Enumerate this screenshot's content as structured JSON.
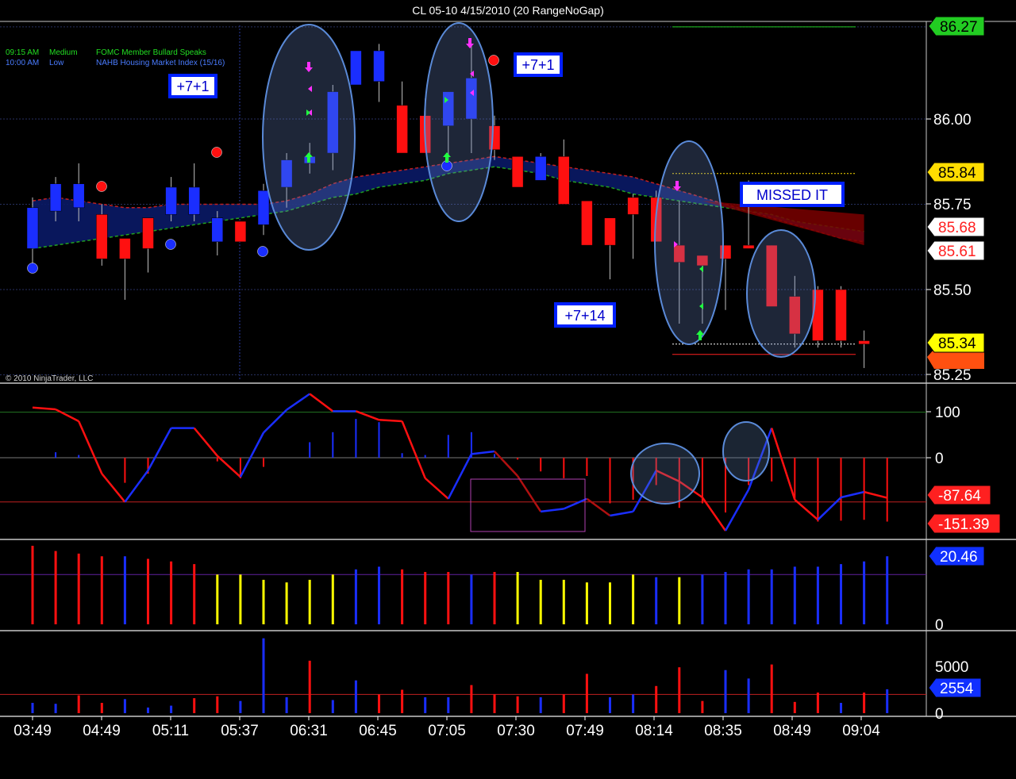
{
  "window": {
    "title": "CL 05-10  4/15/2010 (20 RangeNoGap)"
  },
  "copyright": "© 2010 NinjaTrader, LLC",
  "news": [
    {
      "time": "09:15 AM",
      "impact": "Medium",
      "text": "FOMC Member Bullard Speaks",
      "color": "#22dd22"
    },
    {
      "time": "10:00 AM",
      "impact": "Low",
      "text": "NAHB Housing Market Index (15/16)",
      "color": "#4a7cff"
    }
  ],
  "annotations": [
    {
      "id": "a1",
      "text": "+7+1"
    },
    {
      "id": "a2",
      "text": "+7+1"
    },
    {
      "id": "a3",
      "text": "+7+14"
    },
    {
      "id": "a4",
      "text": "MISSED IT"
    }
  ],
  "chart_data": [
    {
      "type": "candlestick",
      "panel": "price",
      "ylim": [
        85.25,
        86.27
      ],
      "y_ticks": [
        "86.00",
        "85.75",
        "85.50",
        "85.25"
      ],
      "price_badges": [
        {
          "label": "86.27",
          "bg": "#22cc22",
          "fg": "#000000"
        },
        {
          "label": "85.84",
          "bg": "#ffdd00",
          "fg": "#000000"
        },
        {
          "label": "85.68",
          "bg": "#ffffff",
          "fg": "#ff2020"
        },
        {
          "label": "85.61",
          "bg": "#ffffff",
          "fg": "#ff2020"
        },
        {
          "label": "85.34",
          "bg": "#ffff00",
          "fg": "#000000"
        }
      ],
      "candles": [
        {
          "o": 85.62,
          "h": 85.77,
          "l": 85.57,
          "c": 85.74
        },
        {
          "o": 85.73,
          "h": 85.83,
          "l": 85.7,
          "c": 85.81
        },
        {
          "o": 85.74,
          "h": 85.87,
          "l": 85.7,
          "c": 85.81
        },
        {
          "o": 85.72,
          "h": 85.75,
          "l": 85.57,
          "c": 85.59
        },
        {
          "o": 85.65,
          "h": 85.65,
          "l": 85.47,
          "c": 85.59
        },
        {
          "o": 85.71,
          "h": 85.71,
          "l": 85.55,
          "c": 85.62
        },
        {
          "o": 85.72,
          "h": 85.83,
          "l": 85.7,
          "c": 85.8
        },
        {
          "o": 85.72,
          "h": 85.87,
          "l": 85.7,
          "c": 85.8
        },
        {
          "o": 85.64,
          "h": 85.73,
          "l": 85.6,
          "c": 85.71
        },
        {
          "o": 85.7,
          "h": 85.7,
          "l": 85.64,
          "c": 85.64
        },
        {
          "o": 85.69,
          "h": 85.81,
          "l": 85.66,
          "c": 85.79
        },
        {
          "o": 85.8,
          "h": 85.9,
          "l": 85.74,
          "c": 85.88
        },
        {
          "o": 85.87,
          "h": 85.93,
          "l": 85.84,
          "c": 85.89
        },
        {
          "o": 85.9,
          "h": 86.1,
          "l": 85.85,
          "c": 86.08
        },
        {
          "o": 86.1,
          "h": 86.2,
          "l": 86.1,
          "c": 86.2
        },
        {
          "o": 86.11,
          "h": 86.22,
          "l": 86.05,
          "c": 86.2
        },
        {
          "o": 86.04,
          "h": 86.11,
          "l": 85.9,
          "c": 85.9
        },
        {
          "o": 86.01,
          "h": 86.06,
          "l": 85.9,
          "c": 85.9
        },
        {
          "o": 85.98,
          "h": 86.04,
          "l": 85.88,
          "c": 86.08
        },
        {
          "o": 86.0,
          "h": 86.22,
          "l": 85.9,
          "c": 86.12
        },
        {
          "o": 85.98,
          "h": 86.01,
          "l": 85.88,
          "c": 85.91
        },
        {
          "o": 85.89,
          "h": 85.89,
          "l": 85.8,
          "c": 85.8
        },
        {
          "o": 85.82,
          "h": 85.9,
          "l": 85.82,
          "c": 85.89
        },
        {
          "o": 85.89,
          "h": 85.94,
          "l": 85.75,
          "c": 85.75
        },
        {
          "o": 85.76,
          "h": 85.76,
          "l": 85.63,
          "c": 85.63
        },
        {
          "o": 85.71,
          "h": 85.71,
          "l": 85.53,
          "c": 85.63
        },
        {
          "o": 85.77,
          "h": 85.78,
          "l": 85.59,
          "c": 85.72
        },
        {
          "o": 85.77,
          "h": 85.79,
          "l": 85.64,
          "c": 85.64
        },
        {
          "o": 85.63,
          "h": 85.76,
          "l": 85.4,
          "c": 85.58
        },
        {
          "o": 85.6,
          "h": 85.59,
          "l": 85.4,
          "c": 85.57
        },
        {
          "o": 85.63,
          "h": 85.63,
          "l": 85.44,
          "c": 85.59
        },
        {
          "o": 85.63,
          "h": 85.82,
          "l": 85.62,
          "c": 85.62
        },
        {
          "o": 85.63,
          "h": 85.63,
          "l": 85.45,
          "c": 85.45
        },
        {
          "o": 85.48,
          "h": 85.54,
          "l": 85.33,
          "c": 85.37
        },
        {
          "o": 85.5,
          "h": 85.51,
          "l": 85.33,
          "c": 85.35
        },
        {
          "o": 85.5,
          "h": 85.51,
          "l": 85.33,
          "c": 85.35
        },
        {
          "o": 85.35,
          "h": 85.38,
          "l": 85.27,
          "c": 85.34
        }
      ],
      "band_upper": [
        85.76,
        85.77,
        85.76,
        85.75,
        85.74,
        85.74,
        85.75,
        85.75,
        85.75,
        85.75,
        85.75,
        85.76,
        85.78,
        85.81,
        85.83,
        85.84,
        85.85,
        85.86,
        85.87,
        85.88,
        85.89,
        85.88,
        85.87,
        85.86,
        85.85,
        85.84,
        85.83,
        85.81,
        85.79,
        85.77,
        85.75,
        85.73,
        85.71,
        85.69,
        85.67,
        85.65,
        85.64
      ],
      "band_lower": [
        85.62,
        85.63,
        85.64,
        85.65,
        85.66,
        85.67,
        85.68,
        85.69,
        85.7,
        85.71,
        85.72,
        85.73,
        85.75,
        85.77,
        85.78,
        85.8,
        85.81,
        85.82,
        85.84,
        85.85,
        85.86,
        85.85,
        85.84,
        85.82,
        85.81,
        85.8,
        85.78,
        85.77,
        85.76,
        85.75,
        85.74,
        85.73,
        85.72,
        85.7,
        85.69,
        85.68,
        85.67
      ]
    },
    {
      "type": "line",
      "panel": "oscillator",
      "ylim": [
        -170,
        150
      ],
      "y_ticks": [
        "100",
        "0"
      ],
      "badges": [
        {
          "label": "-87.64",
          "bg": "#ff2020"
        },
        {
          "label": "-151.39",
          "bg": "#ff2020"
        }
      ],
      "line": [
        110,
        106,
        80,
        -35,
        -97,
        -28,
        65,
        65,
        4,
        -42,
        55,
        105,
        140,
        102,
        102,
        83,
        80,
        -45,
        -90,
        8,
        14,
        -40,
        -118,
        -112,
        -90,
        -127,
        -118,
        -28,
        -52,
        -87,
        -160,
        -70,
        65,
        -92,
        -136,
        -87,
        -75,
        -88
      ],
      "hist": [
        0,
        12,
        6,
        0,
        -55,
        -35,
        0,
        0,
        -8,
        -45,
        -20,
        0,
        34,
        56,
        85,
        78,
        10,
        6,
        50,
        56,
        8,
        -4,
        -30,
        -45,
        -40,
        -100,
        -92,
        -60,
        -110,
        -100,
        -120,
        -60,
        -52,
        -90,
        -140,
        -138,
        -136,
        -140
      ]
    },
    {
      "type": "bar",
      "panel": "indicator",
      "ylim": [
        0,
        36
      ],
      "y_ticks": [
        "0"
      ],
      "badge": {
        "label": "20.46",
        "bg": "#1030ff"
      },
      "values": [
        30,
        28,
        27,
        26,
        26,
        25,
        24,
        23,
        19,
        19,
        17,
        16,
        17,
        19,
        21,
        22,
        21,
        20,
        20,
        19,
        20,
        20,
        17,
        17,
        16,
        16,
        19,
        18,
        18,
        19,
        20,
        21,
        21,
        22,
        22,
        23,
        24,
        26
      ],
      "colors": [
        "r",
        "r",
        "r",
        "r",
        "b",
        "r",
        "r",
        "r",
        "y",
        "y",
        "y",
        "y",
        "y",
        "y",
        "b",
        "b",
        "r",
        "r",
        "r",
        "b",
        "r",
        "y",
        "y",
        "y",
        "y",
        "y",
        "y",
        "b",
        "y",
        "b",
        "b",
        "b",
        "b",
        "b",
        "b",
        "b",
        "b",
        "b"
      ]
    },
    {
      "type": "bar",
      "panel": "volume",
      "ylim": [
        0,
        6000
      ],
      "y_ticks": [
        "5000",
        "0"
      ],
      "badge": {
        "label": "2554",
        "bg": "#1030ff"
      },
      "values": [
        1100,
        1000,
        1900,
        1100,
        1500,
        600,
        800,
        1600,
        1800,
        1300,
        8000,
        1700,
        5600,
        1400,
        3500,
        2000,
        2500,
        1700,
        1700,
        3000,
        2000,
        1800,
        1700,
        2000,
        4200,
        1700,
        2000,
        2900,
        4900,
        1300,
        4600,
        3700,
        5200,
        1200,
        2200,
        1100,
        2200,
        2554
      ],
      "colors": [
        "b",
        "b",
        "r",
        "r",
        "b",
        "b",
        "b",
        "r",
        "r",
        "b",
        "b",
        "b",
        "r",
        "b",
        "b",
        "r",
        "r",
        "b",
        "b",
        "r",
        "r",
        "r",
        "b",
        "r",
        "r",
        "b",
        "b",
        "r",
        "r",
        "r",
        "b",
        "b",
        "r",
        "r",
        "r",
        "b",
        "r",
        "b"
      ]
    }
  ],
  "x_axis": {
    "labels": [
      "03:49",
      "04:49",
      "05:11",
      "05:37",
      "06:31",
      "06:45",
      "07:05",
      "07:30",
      "07:49",
      "08:14",
      "08:35",
      "08:49",
      "09:04"
    ]
  },
  "colors": {
    "up": "#1a2eff",
    "down": "#ff1010",
    "fill": "#0a1a66",
    "grid": "#27305f"
  }
}
